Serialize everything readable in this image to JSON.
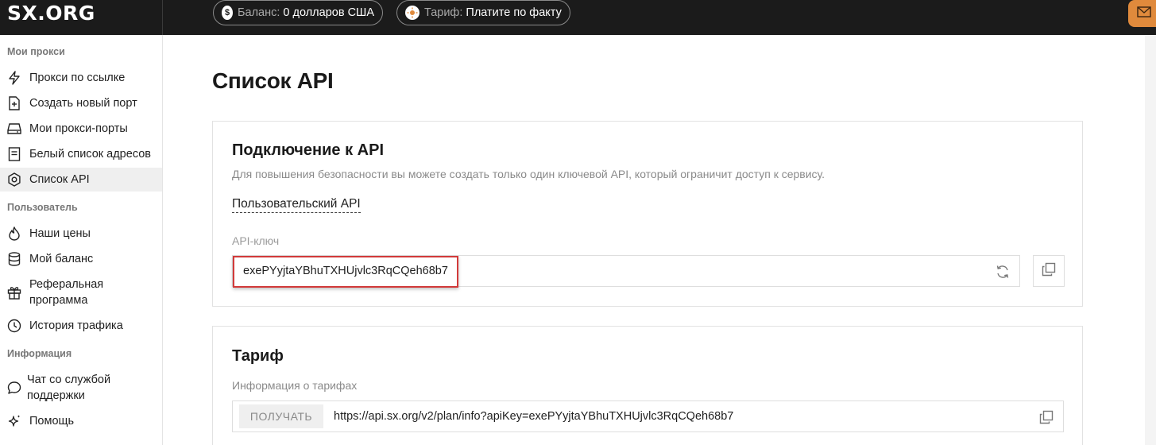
{
  "header": {
    "logo": "SX.ORG",
    "balance": {
      "label": "Баланс:",
      "value": "0 долларов США",
      "icon": "dollar-icon"
    },
    "tariff": {
      "label": "Тариф:",
      "value": "Платите по факту",
      "icon": "sun-icon"
    },
    "mail_icon": "mail-icon",
    "colors": {
      "bar": "#1b1b1b",
      "accent": "#e08a3c"
    }
  },
  "sidebar": {
    "sections": [
      {
        "title": "Мои прокси",
        "items": [
          {
            "label": "Прокси по ссылке",
            "icon": "lightning-icon"
          },
          {
            "label": "Создать новый порт",
            "icon": "add-file-icon"
          },
          {
            "label": "Мои прокси-порты",
            "icon": "server-icon"
          },
          {
            "label": "Белый список адресов",
            "icon": "list-icon"
          },
          {
            "label": "Список API",
            "icon": "gear-icon",
            "active": true
          }
        ]
      },
      {
        "title": "Пользователь",
        "items": [
          {
            "label": "Наши цены",
            "icon": "fire-icon"
          },
          {
            "label": "Мой баланс",
            "icon": "database-icon"
          },
          {
            "label": "Реферальная программа",
            "line1": "Реферальная",
            "line2": "программа",
            "icon": "gift-icon"
          },
          {
            "label": "История трафика",
            "icon": "history-icon"
          }
        ]
      },
      {
        "title": "Информация",
        "items": [
          {
            "label": "Чат со службой поддержки",
            "line1": "Чат со службой",
            "line2": "поддержки",
            "icon": "chat-icon"
          },
          {
            "label": "Помощь",
            "icon": "sparkle-icon"
          }
        ]
      }
    ]
  },
  "main": {
    "title": "Список API",
    "api_card": {
      "title": "Подключение к API",
      "description": "Для повышения безопасности вы можете создать только один ключевой API, который ограничит доступ к сервису.",
      "custom_api": "Пользовательский API",
      "key_label": "API-ключ",
      "key_value": "exePYyjtaYBhuTXHUjvlc3RqCQeh68b7",
      "refresh_icon": "refresh-icon",
      "copy_icon": "copy-icon"
    },
    "tariff_card": {
      "title": "Тариф",
      "info_label": "Информация о тарифах",
      "method": "ПОЛУЧАТЬ",
      "url": "https://api.sx.org/v2/plan/info?apiKey=exePYyjtaYBhuTXHUjvlc3RqCQeh68b7",
      "copy_icon": "copy-icon"
    }
  }
}
